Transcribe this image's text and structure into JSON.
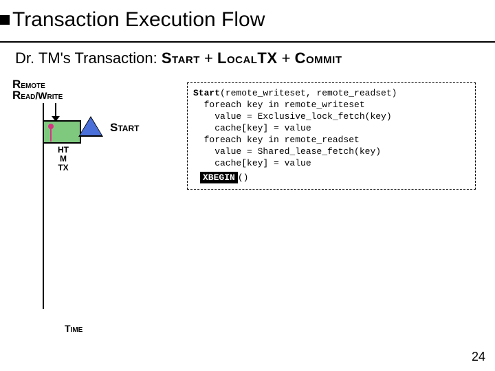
{
  "title": "Transaction Execution Flow",
  "subtitle": {
    "prefix": "Dr. TM's Transaction: ",
    "p1": "Start",
    "plus1": " + ",
    "p2": "LocalTX",
    "plus2": " + ",
    "p3": "Commit"
  },
  "remote": {
    "line1a": "R",
    "line1b": "emote",
    "line2a": "R",
    "line2b": "ead",
    "line2c": "/W",
    "line2d": "rite"
  },
  "htm": {
    "l1": "HT",
    "l2": "M",
    "l3": "TX"
  },
  "start_label": "Start",
  "time_label": "Time",
  "code": {
    "l1a": "Start",
    "l1b": "(remote_writeset, remote_readset)",
    "l2": "  foreach key in remote_writeset",
    "l3": "    value = Exclusive_lock_fetch(key)",
    "l4": "    cache[key] = value",
    "l5": "  foreach key in remote_readset",
    "l6": "    value = Shared_lease_fetch(key)",
    "l7": "    cache[key] = value",
    "xbegin": "XBEGIN",
    "xparen": "()"
  },
  "page": "24"
}
